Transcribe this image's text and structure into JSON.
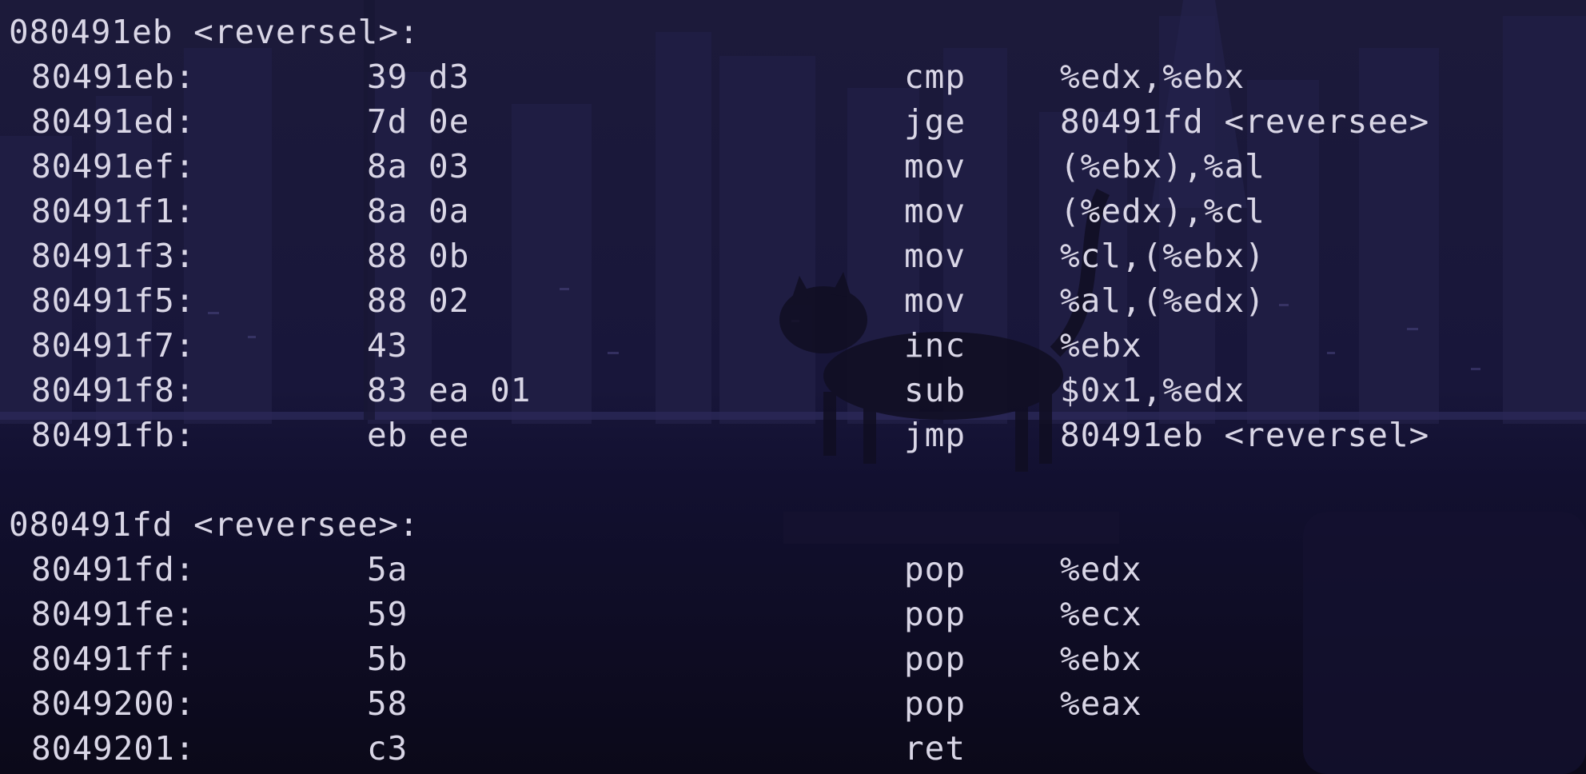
{
  "terminal": {
    "blocks": [
      {
        "label": "080491eb <reversel>:",
        "rows": [
          {
            "addr": "80491eb:",
            "bytes": "39 d3",
            "mnemonic": "cmp",
            "operands": "%edx,%ebx"
          },
          {
            "addr": "80491ed:",
            "bytes": "7d 0e",
            "mnemonic": "jge",
            "operands": "80491fd <reversee>"
          },
          {
            "addr": "80491ef:",
            "bytes": "8a 03",
            "mnemonic": "mov",
            "operands": "(%ebx),%al"
          },
          {
            "addr": "80491f1:",
            "bytes": "8a 0a",
            "mnemonic": "mov",
            "operands": "(%edx),%cl"
          },
          {
            "addr": "80491f3:",
            "bytes": "88 0b",
            "mnemonic": "mov",
            "operands": "%cl,(%ebx)"
          },
          {
            "addr": "80491f5:",
            "bytes": "88 02",
            "mnemonic": "mov",
            "operands": "%al,(%edx)"
          },
          {
            "addr": "80491f7:",
            "bytes": "43",
            "mnemonic": "inc",
            "operands": "%ebx"
          },
          {
            "addr": "80491f8:",
            "bytes": "83 ea 01",
            "mnemonic": "sub",
            "operands": "$0x1,%edx"
          },
          {
            "addr": "80491fb:",
            "bytes": "eb ee",
            "mnemonic": "jmp",
            "operands": "80491eb <reversel>"
          }
        ]
      },
      {
        "label": "080491fd <reversee>:",
        "rows": [
          {
            "addr": "80491fd:",
            "bytes": "5a",
            "mnemonic": "pop",
            "operands": "%edx"
          },
          {
            "addr": "80491fe:",
            "bytes": "59",
            "mnemonic": "pop",
            "operands": "%ecx"
          },
          {
            "addr": "80491ff:",
            "bytes": "5b",
            "mnemonic": "pop",
            "operands": "%ebx"
          },
          {
            "addr": "8049200:",
            "bytes": "58",
            "mnemonic": "pop",
            "operands": "%eax"
          },
          {
            "addr": "8049201:",
            "bytes": "c3",
            "mnemonic": "ret",
            "operands": ""
          }
        ]
      }
    ]
  },
  "colors": {
    "text": "#d9d6e6",
    "background": "#0f0c1f"
  }
}
